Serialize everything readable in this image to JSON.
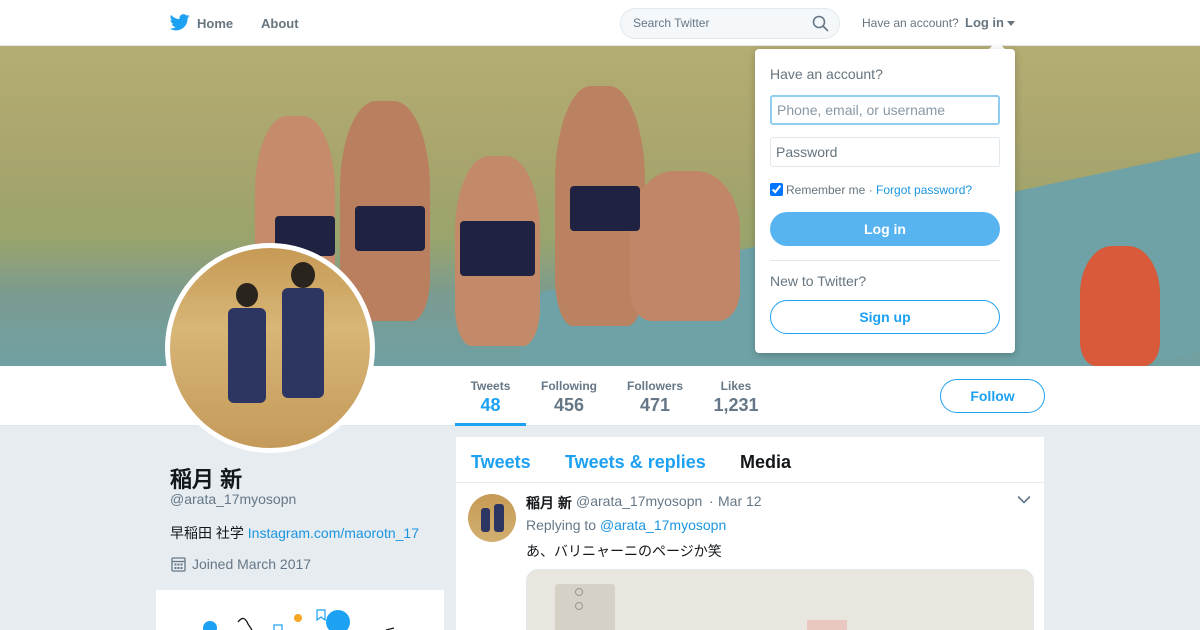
{
  "nav": {
    "home": "Home",
    "about": "About",
    "search_placeholder": "Search Twitter",
    "have_account": "Have an account?",
    "login": "Log in"
  },
  "profile": {
    "name": "稲月 新",
    "handle": "@arata_17myosopn",
    "bio_text": "早稲田 社学 ",
    "bio_link": "Instagram.com/maorotn_17",
    "joined": "Joined March 2017"
  },
  "stats": [
    {
      "label": "Tweets",
      "value": "48"
    },
    {
      "label": "Following",
      "value": "456"
    },
    {
      "label": "Followers",
      "value": "471"
    },
    {
      "label": "Likes",
      "value": "1,231"
    }
  ],
  "follow_label": "Follow",
  "timeline": {
    "tabs": [
      "Tweets",
      "Tweets & replies",
      "Media"
    ],
    "tweet": {
      "name": "稲月 新",
      "handle": "@arata_17myosopn",
      "dot": "·",
      "date": "Mar 12",
      "replying_prefix": "Replying to ",
      "replying_handle": "@arata_17myosopn",
      "text": "あ、バリニャーニのページか笑"
    }
  },
  "login_dropdown": {
    "title": "Have an account?",
    "username_placeholder": "Phone, email, or username",
    "password_placeholder": "Password",
    "remember": "Remember me",
    "separator": " · ",
    "forgot": "Forgot password?",
    "login_button": "Log in",
    "new_to": "New to Twitter?",
    "signup_button": "Sign up"
  },
  "colors": {
    "accent": "#1da1f2",
    "link": "#1b95e0",
    "login_button_bg": "#58b4f0"
  }
}
